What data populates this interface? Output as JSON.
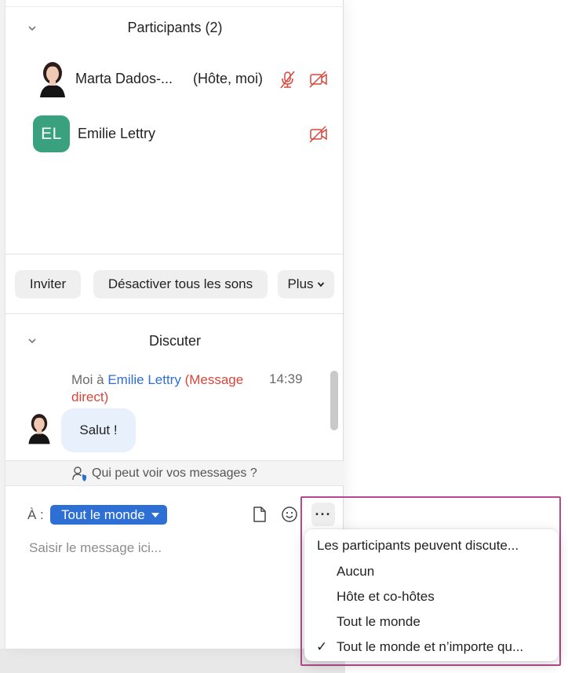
{
  "participants": {
    "title": "Participants (2)",
    "list": [
      {
        "name": "Marta Dados-...",
        "role": "(Hôte, moi)"
      },
      {
        "initials": "EL",
        "name": "Emilie Lettry"
      }
    ]
  },
  "actions": {
    "invite": "Inviter",
    "mute_all": "Désactiver tous les sons",
    "more": "Plus"
  },
  "chat": {
    "title": "Discuter",
    "message": {
      "from": "Moi à",
      "to": "Emilie Lettry",
      "type": "(Message direct)",
      "time": "14:39",
      "text": "Salut !"
    },
    "who_can_see": "Qui peut voir vos messages ?",
    "to_label": "À :",
    "recipient": "Tout le monde",
    "placeholder": "Saisir le message ici...",
    "more_label": "···"
  },
  "menu": {
    "header": "Les participants peuvent discute...",
    "items": [
      "Aucun",
      "Hôte et co-hôtes",
      "Tout le monde",
      "Tout le monde et n’importe qu..."
    ],
    "selected_index": 3,
    "check": "✓"
  },
  "colors": {
    "accent_blue": "#2e6fd6",
    "avatar_green": "#3aa17f",
    "alert_red": "#d9453b",
    "highlight": "#b44a8c"
  }
}
